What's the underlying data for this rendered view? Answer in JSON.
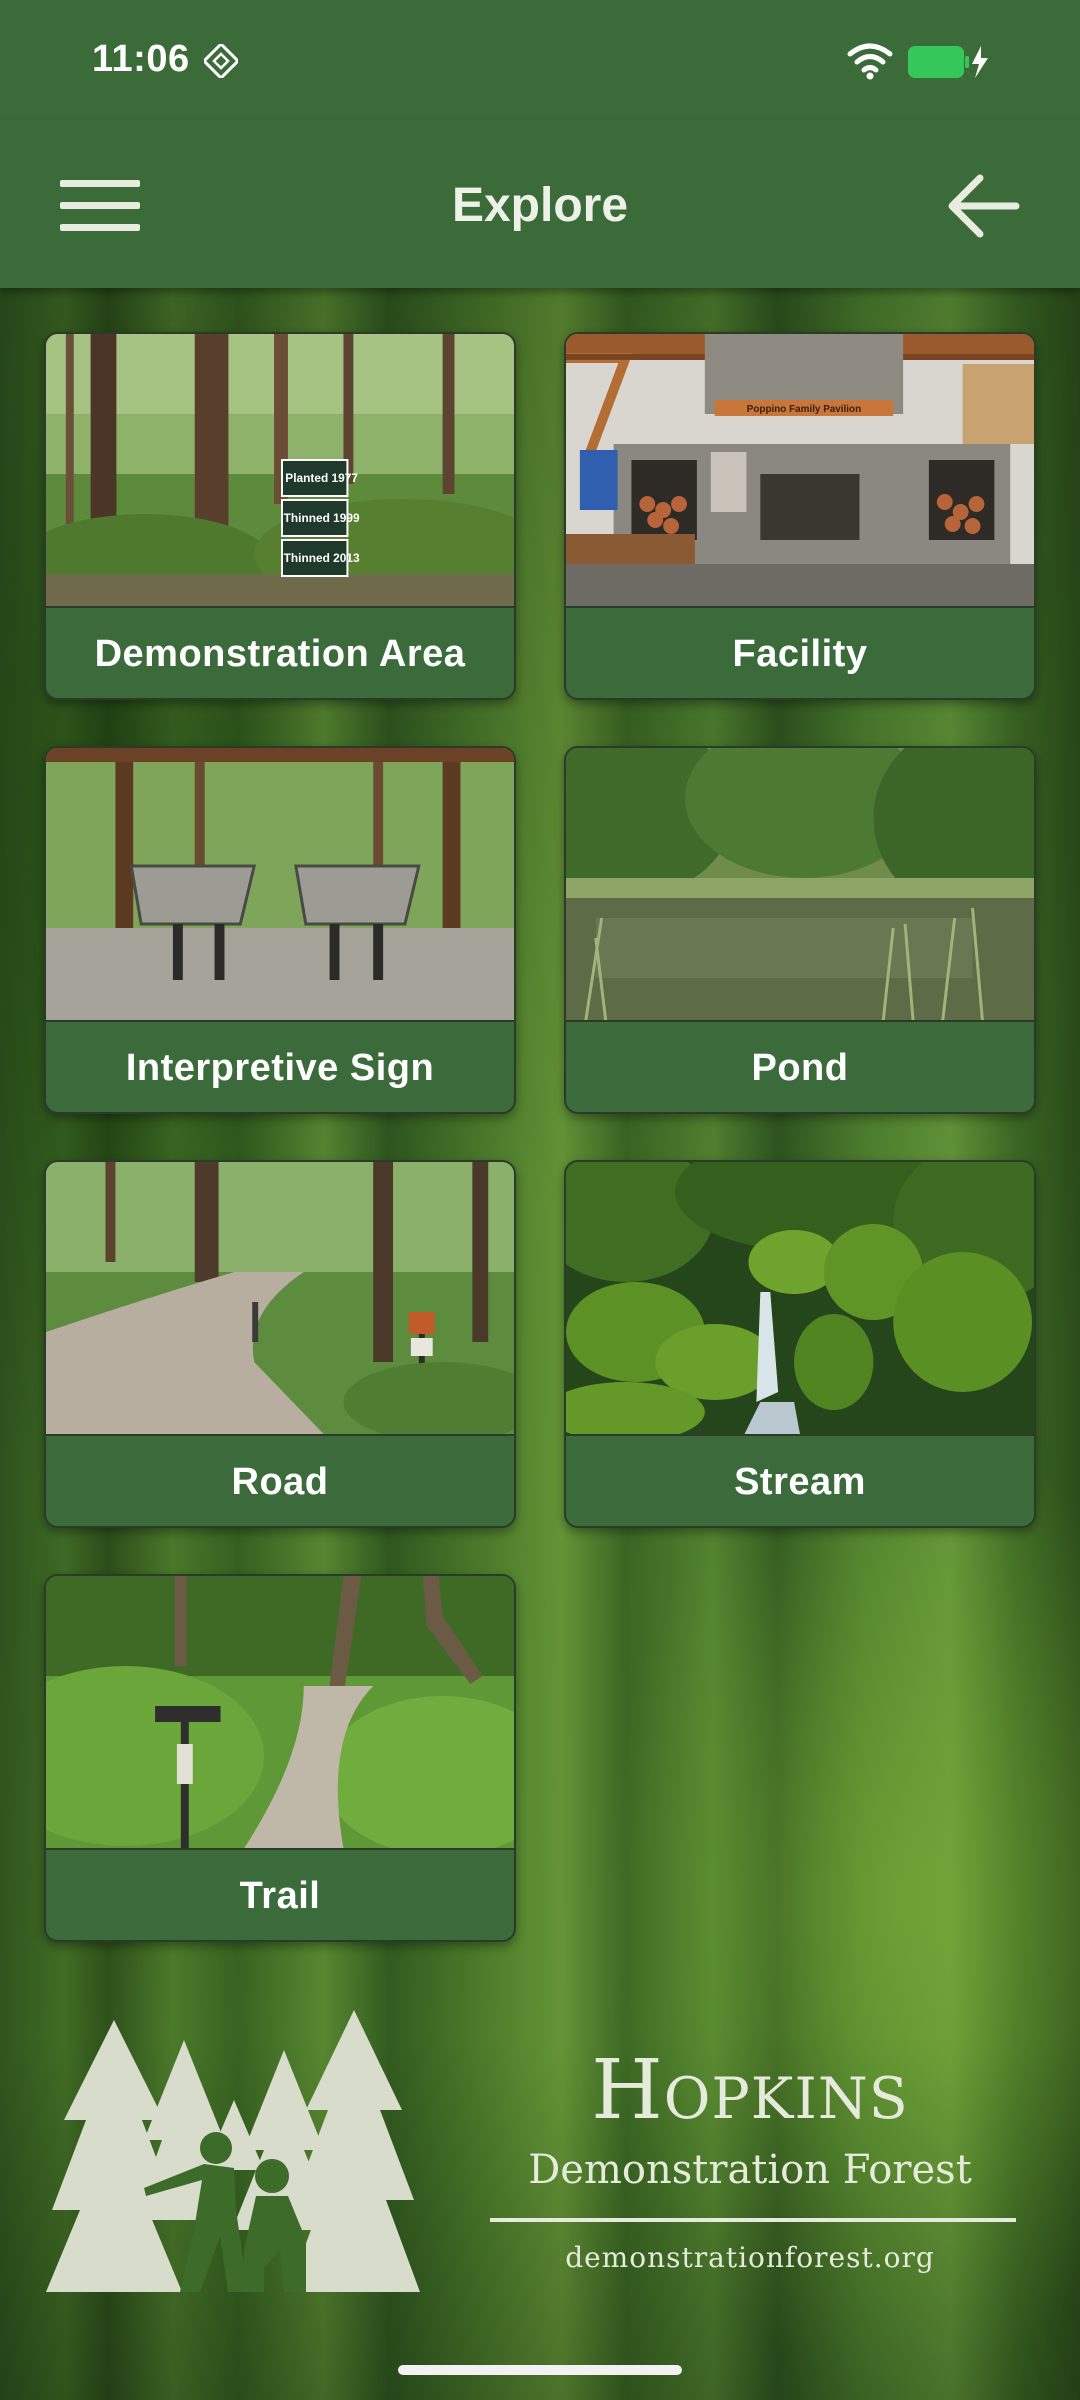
{
  "status_bar": {
    "time": "11:06",
    "icons": [
      "nfc-icon",
      "wifi-icon",
      "battery-charging-icon"
    ],
    "battery_color": "#34c759"
  },
  "app_bar": {
    "title": "Explore",
    "menu_icon": "hamburger-menu-icon",
    "back_icon": "arrow-left-icon"
  },
  "colors": {
    "bar": "#3c6b3a",
    "tile_label_bg": "#3b6b3b",
    "text": "#ffffff"
  },
  "categories": [
    {
      "label": "Demonstration Area",
      "sign_text": [
        "Planted 1977",
        "Thinned 1999",
        "Thinned 2013"
      ]
    },
    {
      "label": "Facility",
      "sign_text": [
        "Poppino Family Pavilion"
      ]
    },
    {
      "label": "Interpretive Sign"
    },
    {
      "label": "Pond"
    },
    {
      "label": "Road"
    },
    {
      "label": "Stream"
    },
    {
      "label": "Trail"
    }
  ],
  "logo": {
    "name": "Hopkins",
    "subtitle": "Demonstration Forest",
    "url": "demonstrationforest.org"
  }
}
